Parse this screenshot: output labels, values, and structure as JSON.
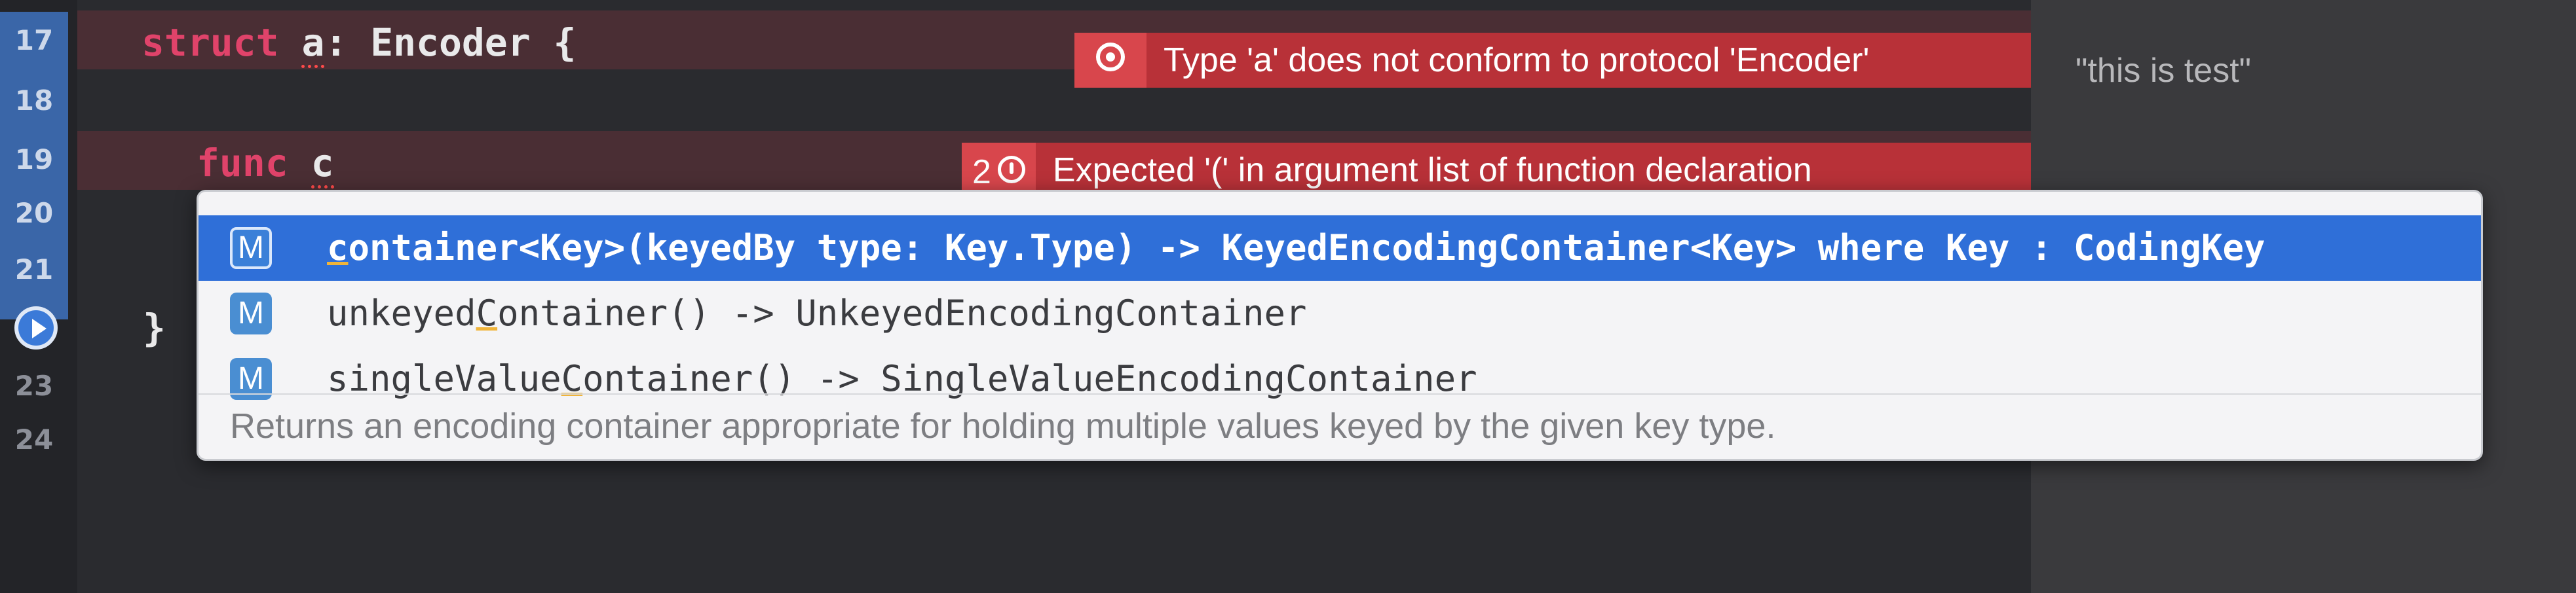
{
  "gutter": {
    "line_numbers": [
      "17",
      "18",
      "19",
      "20",
      "21",
      "23",
      "24"
    ]
  },
  "code": {
    "line17": {
      "keyword": "struct",
      "name": "a",
      "rest": ": Encoder {"
    },
    "line19": {
      "keyword": "func",
      "name": "c"
    },
    "line22": {
      "text": "}"
    }
  },
  "errors": [
    {
      "message": "Type 'a' does not conform to protocol 'Encoder'"
    },
    {
      "count": "2",
      "message": "Expected '(' in argument list of function declaration"
    }
  ],
  "results_pane": {
    "text": "\"this is test\""
  },
  "completions": {
    "badge": "M",
    "items": [
      {
        "pre": "",
        "hl": "c",
        "post": "ontainer<Key>(keyedBy type: Key.Type) -> KeyedEncodingContainer<Key> where Key : CodingKey"
      },
      {
        "pre": "unkeyed",
        "hl": "C",
        "post": "ontainer() -> UnkeyedEncodingContainer"
      },
      {
        "pre": "singleValue",
        "hl": "C",
        "post": "ontainer() -> SingleValueEncodingContainer"
      }
    ],
    "doc": "Returns an encoding container appropriate for holding multiple values keyed by the given key type."
  },
  "colors": {
    "error_red": "#b83138",
    "selection_blue": "#2f6fd8",
    "keyword_pink": "#e0436a",
    "gutter_blue": "#3a66a8"
  }
}
